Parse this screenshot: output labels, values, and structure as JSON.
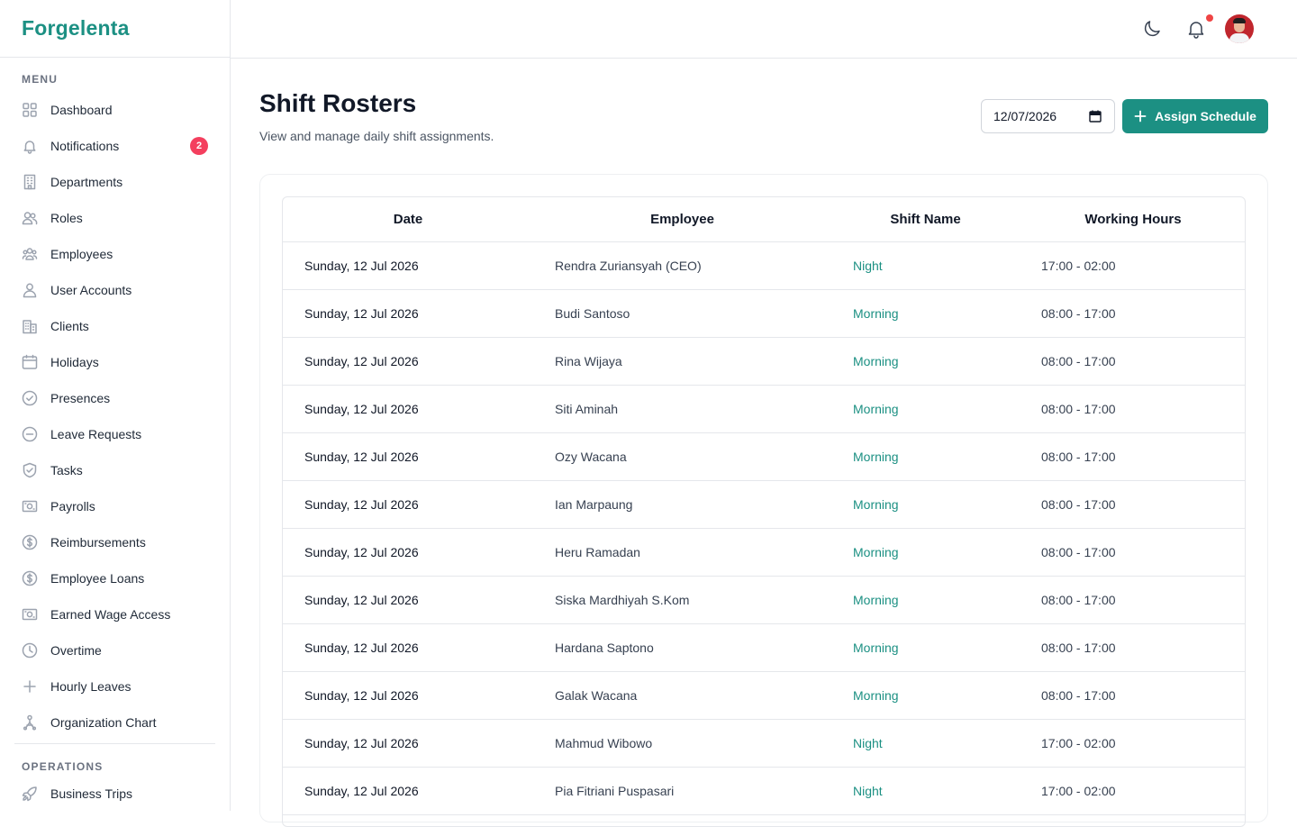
{
  "brand": {
    "name": "Forgelenta"
  },
  "sidebar": {
    "menu_label": "MENU",
    "items": [
      {
        "label": "Dashboard",
        "icon": "grid-icon"
      },
      {
        "label": "Notifications",
        "icon": "bell-icon",
        "badge": "2"
      },
      {
        "label": "Departments",
        "icon": "building-icon"
      },
      {
        "label": "Roles",
        "icon": "users-icon"
      },
      {
        "label": "Employees",
        "icon": "user-group-icon"
      },
      {
        "label": "User Accounts",
        "icon": "user-icon"
      },
      {
        "label": "Clients",
        "icon": "office-icon"
      },
      {
        "label": "Holidays",
        "icon": "calendar-icon"
      },
      {
        "label": "Presences",
        "icon": "check-circle-icon"
      },
      {
        "label": "Leave Requests",
        "icon": "minus-circle-icon"
      },
      {
        "label": "Tasks",
        "icon": "shield-check-icon"
      },
      {
        "label": "Payrolls",
        "icon": "banknote-icon"
      },
      {
        "label": "Reimbursements",
        "icon": "dollar-circle-icon"
      },
      {
        "label": "Employee Loans",
        "icon": "dollar-circle-icon"
      },
      {
        "label": "Earned Wage Access",
        "icon": "banknote-icon"
      },
      {
        "label": "Overtime",
        "icon": "clock-icon"
      },
      {
        "label": "Hourly Leaves",
        "icon": "plus-icon"
      },
      {
        "label": "Organization Chart",
        "icon": "org-chart-icon"
      }
    ],
    "operations_label": "OPERATIONS",
    "operations_items": [
      {
        "label": "Business Trips",
        "icon": "rocket-icon"
      }
    ]
  },
  "header": {
    "theme_toggle_icon": "moon-icon",
    "notifications_icon": "bell-icon",
    "notification_dot_color": "#ef4444"
  },
  "page": {
    "title": "Shift Rosters",
    "subtitle": "View and manage daily shift assignments.",
    "date_value": "12/07/2026",
    "assign_label": "Assign Schedule"
  },
  "colors": {
    "accent": "#1c9083",
    "badge": "#f43f5e"
  },
  "table": {
    "columns": [
      "Date",
      "Employee",
      "Shift Name",
      "Working Hours"
    ],
    "rows": [
      {
        "date": "Sunday, 12 Jul 2026",
        "employee": "Rendra Zuriansyah (CEO)",
        "shift": "Night",
        "hours": "17:00 - 02:00"
      },
      {
        "date": "Sunday, 12 Jul 2026",
        "employee": "Budi Santoso",
        "shift": "Morning",
        "hours": "08:00 - 17:00"
      },
      {
        "date": "Sunday, 12 Jul 2026",
        "employee": "Rina Wijaya",
        "shift": "Morning",
        "hours": "08:00 - 17:00"
      },
      {
        "date": "Sunday, 12 Jul 2026",
        "employee": "Siti Aminah",
        "shift": "Morning",
        "hours": "08:00 - 17:00"
      },
      {
        "date": "Sunday, 12 Jul 2026",
        "employee": "Ozy Wacana",
        "shift": "Morning",
        "hours": "08:00 - 17:00"
      },
      {
        "date": "Sunday, 12 Jul 2026",
        "employee": "Ian Marpaung",
        "shift": "Morning",
        "hours": "08:00 - 17:00"
      },
      {
        "date": "Sunday, 12 Jul 2026",
        "employee": "Heru Ramadan",
        "shift": "Morning",
        "hours": "08:00 - 17:00"
      },
      {
        "date": "Sunday, 12 Jul 2026",
        "employee": "Siska Mardhiyah S.Kom",
        "shift": "Morning",
        "hours": "08:00 - 17:00"
      },
      {
        "date": "Sunday, 12 Jul 2026",
        "employee": "Hardana Saptono",
        "shift": "Morning",
        "hours": "08:00 - 17:00"
      },
      {
        "date": "Sunday, 12 Jul 2026",
        "employee": "Galak Wacana",
        "shift": "Morning",
        "hours": "08:00 - 17:00"
      },
      {
        "date": "Sunday, 12 Jul 2026",
        "employee": "Mahmud Wibowo",
        "shift": "Night",
        "hours": "17:00 - 02:00"
      },
      {
        "date": "Sunday, 12 Jul 2026",
        "employee": "Pia Fitriani Puspasari",
        "shift": "Night",
        "hours": "17:00 - 02:00"
      }
    ]
  }
}
